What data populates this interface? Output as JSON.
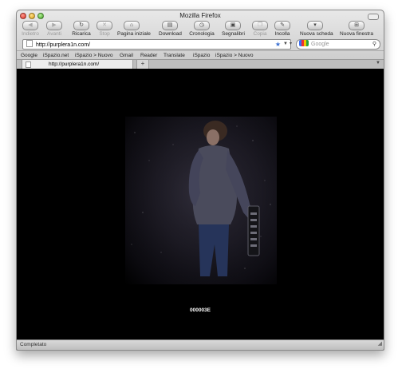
{
  "window": {
    "title": "Mozilla Firefox"
  },
  "toolbar": {
    "back": "Indietro",
    "forward": "Avanti",
    "reload": "Ricarica",
    "stop": "Stop",
    "home": "Pagina iniziale",
    "download": "Download",
    "history": "Cronologia",
    "bookmarks": "Segnalibri",
    "copy": "Copia",
    "paste": "Incolla",
    "new_tab": "Nuova scheda",
    "new_window": "Nuova finestra"
  },
  "address_bar": {
    "url": "http://purplera1n.com/"
  },
  "search": {
    "placeholder": "Google"
  },
  "bookmarks_bar": [
    "Google",
    "iSpazio.net",
    "iSpazio > Nuovo",
    "Gmail",
    "Reader",
    "Translate",
    "iSpazio",
    "iSpazio > Nuovo"
  ],
  "tabs": [
    {
      "title": "http://purplera1n.com/"
    }
  ],
  "new_tab_symbol": "+",
  "page": {
    "caption": "000003E"
  },
  "status": {
    "text": "Completato"
  },
  "icons": {
    "back": "back-arrow-icon",
    "forward": "forward-arrow-icon",
    "reload": "reload-icon",
    "stop": "stop-icon",
    "home": "home-icon",
    "download": "download-icon",
    "history": "history-icon",
    "bookmarks": "bookmarks-icon",
    "copy": "copy-icon",
    "paste": "paste-icon",
    "new_tab": "new-tab-icon",
    "new_window": "new-window-icon"
  },
  "colors": {
    "page_background": "#000000",
    "caption": "#ffffff",
    "star": "#3a6fd1"
  }
}
